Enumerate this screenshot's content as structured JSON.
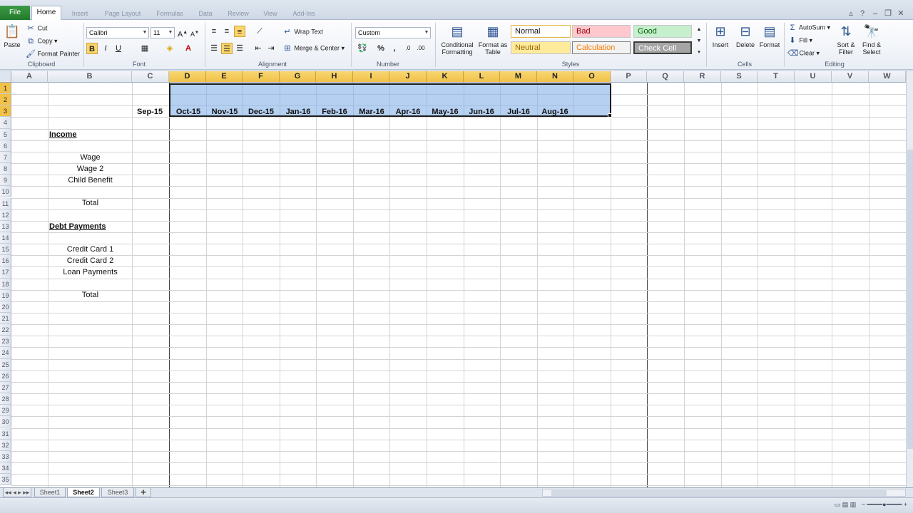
{
  "ribbon_tabs": {
    "file": "File",
    "home": "Home",
    "insert": "Insert",
    "page_layout": "Page Layout",
    "formulas": "Formulas",
    "data": "Data",
    "review": "Review",
    "view": "View",
    "addins": "Add-Ins"
  },
  "clipboard": {
    "paste": "Paste",
    "cut": "Cut",
    "copy": "Copy",
    "format_painter": "Format Painter",
    "label": "Clipboard"
  },
  "font": {
    "name": "Calibri",
    "size": "11",
    "label": "Font"
  },
  "alignment": {
    "wrap_text": "Wrap Text",
    "merge_center": "Merge & Center",
    "label": "Alignment"
  },
  "number": {
    "format": "Custom",
    "percent": "%",
    "comma": ",",
    "label": "Number"
  },
  "styles": {
    "conditional": "Conditional Formatting",
    "format_table": "Format as Table",
    "normal": "Normal",
    "bad": "Bad",
    "good": "Good",
    "neutral": "Neutral",
    "calculation": "Calculation",
    "check_cell": "Check Cell",
    "label": "Styles"
  },
  "cells": {
    "insert": "Insert",
    "delete": "Delete",
    "format": "Format",
    "label": "Cells"
  },
  "editing": {
    "autosum": "AutoSum",
    "fill": "Fill",
    "clear": "Clear",
    "sort_filter": "Sort & Filter",
    "find_select": "Find & Select",
    "label": "Editing"
  },
  "columns": [
    "A",
    "B",
    "C",
    "D",
    "E",
    "F",
    "G",
    "H",
    "I",
    "J",
    "K",
    "L",
    "M",
    "N",
    "O",
    "P",
    "Q",
    "R",
    "S",
    "T",
    "U",
    "V",
    "W"
  ],
  "selected_columns": [
    "D",
    "E",
    "F",
    "G",
    "H",
    "I",
    "J",
    "K",
    "L",
    "M",
    "N",
    "O"
  ],
  "rows": [
    "1",
    "2",
    "3",
    "4",
    "5",
    "6",
    "7",
    "8",
    "9",
    "10",
    "11",
    "12",
    "13",
    "14",
    "15",
    "16",
    "17",
    "18",
    "19",
    "20",
    "21",
    "22",
    "23",
    "24",
    "25",
    "26",
    "27",
    "28",
    "29",
    "30",
    "31",
    "32",
    "33",
    "34",
    "35"
  ],
  "months": {
    "c": "Sep-15",
    "d": "Oct-15",
    "e": "Nov-15",
    "f": "Dec-15",
    "g": "Jan-16",
    "h": "Feb-16",
    "i": "Mar-16",
    "j": "Apr-16",
    "k": "May-16",
    "l": "Jun-16",
    "m": "Jul-16",
    "n": "Aug-16"
  },
  "income": {
    "heading": "Income",
    "wage": "Wage",
    "wage2": "Wage 2",
    "child_benefit": "Child Benefit",
    "total": "Total"
  },
  "debt": {
    "heading": "Debt Payments",
    "cc1": "Credit Card 1",
    "cc2": "Credit Card 2",
    "loan": "Loan Payments",
    "total": "Total"
  },
  "sheets": {
    "sheet1": "Sheet1",
    "sheet2": "Sheet2",
    "sheet3": "Sheet3"
  },
  "colors": {
    "accent": "#f1c148",
    "selection": "#78aae6",
    "file_tab": "#2e8b37"
  }
}
